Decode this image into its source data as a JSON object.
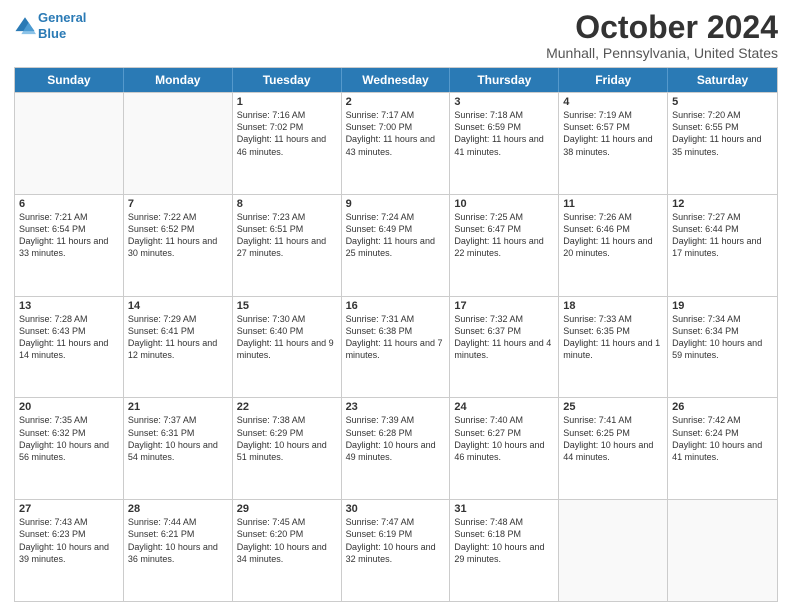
{
  "header": {
    "logo_line1": "General",
    "logo_line2": "Blue",
    "title": "October 2024",
    "subtitle": "Munhall, Pennsylvania, United States"
  },
  "days_of_week": [
    "Sunday",
    "Monday",
    "Tuesday",
    "Wednesday",
    "Thursday",
    "Friday",
    "Saturday"
  ],
  "weeks": [
    [
      {
        "day": "",
        "sunrise": "",
        "sunset": "",
        "daylight": ""
      },
      {
        "day": "",
        "sunrise": "",
        "sunset": "",
        "daylight": ""
      },
      {
        "day": "1",
        "sunrise": "Sunrise: 7:16 AM",
        "sunset": "Sunset: 7:02 PM",
        "daylight": "Daylight: 11 hours and 46 minutes."
      },
      {
        "day": "2",
        "sunrise": "Sunrise: 7:17 AM",
        "sunset": "Sunset: 7:00 PM",
        "daylight": "Daylight: 11 hours and 43 minutes."
      },
      {
        "day": "3",
        "sunrise": "Sunrise: 7:18 AM",
        "sunset": "Sunset: 6:59 PM",
        "daylight": "Daylight: 11 hours and 41 minutes."
      },
      {
        "day": "4",
        "sunrise": "Sunrise: 7:19 AM",
        "sunset": "Sunset: 6:57 PM",
        "daylight": "Daylight: 11 hours and 38 minutes."
      },
      {
        "day": "5",
        "sunrise": "Sunrise: 7:20 AM",
        "sunset": "Sunset: 6:55 PM",
        "daylight": "Daylight: 11 hours and 35 minutes."
      }
    ],
    [
      {
        "day": "6",
        "sunrise": "Sunrise: 7:21 AM",
        "sunset": "Sunset: 6:54 PM",
        "daylight": "Daylight: 11 hours and 33 minutes."
      },
      {
        "day": "7",
        "sunrise": "Sunrise: 7:22 AM",
        "sunset": "Sunset: 6:52 PM",
        "daylight": "Daylight: 11 hours and 30 minutes."
      },
      {
        "day": "8",
        "sunrise": "Sunrise: 7:23 AM",
        "sunset": "Sunset: 6:51 PM",
        "daylight": "Daylight: 11 hours and 27 minutes."
      },
      {
        "day": "9",
        "sunrise": "Sunrise: 7:24 AM",
        "sunset": "Sunset: 6:49 PM",
        "daylight": "Daylight: 11 hours and 25 minutes."
      },
      {
        "day": "10",
        "sunrise": "Sunrise: 7:25 AM",
        "sunset": "Sunset: 6:47 PM",
        "daylight": "Daylight: 11 hours and 22 minutes."
      },
      {
        "day": "11",
        "sunrise": "Sunrise: 7:26 AM",
        "sunset": "Sunset: 6:46 PM",
        "daylight": "Daylight: 11 hours and 20 minutes."
      },
      {
        "day": "12",
        "sunrise": "Sunrise: 7:27 AM",
        "sunset": "Sunset: 6:44 PM",
        "daylight": "Daylight: 11 hours and 17 minutes."
      }
    ],
    [
      {
        "day": "13",
        "sunrise": "Sunrise: 7:28 AM",
        "sunset": "Sunset: 6:43 PM",
        "daylight": "Daylight: 11 hours and 14 minutes."
      },
      {
        "day": "14",
        "sunrise": "Sunrise: 7:29 AM",
        "sunset": "Sunset: 6:41 PM",
        "daylight": "Daylight: 11 hours and 12 minutes."
      },
      {
        "day": "15",
        "sunrise": "Sunrise: 7:30 AM",
        "sunset": "Sunset: 6:40 PM",
        "daylight": "Daylight: 11 hours and 9 minutes."
      },
      {
        "day": "16",
        "sunrise": "Sunrise: 7:31 AM",
        "sunset": "Sunset: 6:38 PM",
        "daylight": "Daylight: 11 hours and 7 minutes."
      },
      {
        "day": "17",
        "sunrise": "Sunrise: 7:32 AM",
        "sunset": "Sunset: 6:37 PM",
        "daylight": "Daylight: 11 hours and 4 minutes."
      },
      {
        "day": "18",
        "sunrise": "Sunrise: 7:33 AM",
        "sunset": "Sunset: 6:35 PM",
        "daylight": "Daylight: 11 hours and 1 minute."
      },
      {
        "day": "19",
        "sunrise": "Sunrise: 7:34 AM",
        "sunset": "Sunset: 6:34 PM",
        "daylight": "Daylight: 10 hours and 59 minutes."
      }
    ],
    [
      {
        "day": "20",
        "sunrise": "Sunrise: 7:35 AM",
        "sunset": "Sunset: 6:32 PM",
        "daylight": "Daylight: 10 hours and 56 minutes."
      },
      {
        "day": "21",
        "sunrise": "Sunrise: 7:37 AM",
        "sunset": "Sunset: 6:31 PM",
        "daylight": "Daylight: 10 hours and 54 minutes."
      },
      {
        "day": "22",
        "sunrise": "Sunrise: 7:38 AM",
        "sunset": "Sunset: 6:29 PM",
        "daylight": "Daylight: 10 hours and 51 minutes."
      },
      {
        "day": "23",
        "sunrise": "Sunrise: 7:39 AM",
        "sunset": "Sunset: 6:28 PM",
        "daylight": "Daylight: 10 hours and 49 minutes."
      },
      {
        "day": "24",
        "sunrise": "Sunrise: 7:40 AM",
        "sunset": "Sunset: 6:27 PM",
        "daylight": "Daylight: 10 hours and 46 minutes."
      },
      {
        "day": "25",
        "sunrise": "Sunrise: 7:41 AM",
        "sunset": "Sunset: 6:25 PM",
        "daylight": "Daylight: 10 hours and 44 minutes."
      },
      {
        "day": "26",
        "sunrise": "Sunrise: 7:42 AM",
        "sunset": "Sunset: 6:24 PM",
        "daylight": "Daylight: 10 hours and 41 minutes."
      }
    ],
    [
      {
        "day": "27",
        "sunrise": "Sunrise: 7:43 AM",
        "sunset": "Sunset: 6:23 PM",
        "daylight": "Daylight: 10 hours and 39 minutes."
      },
      {
        "day": "28",
        "sunrise": "Sunrise: 7:44 AM",
        "sunset": "Sunset: 6:21 PM",
        "daylight": "Daylight: 10 hours and 36 minutes."
      },
      {
        "day": "29",
        "sunrise": "Sunrise: 7:45 AM",
        "sunset": "Sunset: 6:20 PM",
        "daylight": "Daylight: 10 hours and 34 minutes."
      },
      {
        "day": "30",
        "sunrise": "Sunrise: 7:47 AM",
        "sunset": "Sunset: 6:19 PM",
        "daylight": "Daylight: 10 hours and 32 minutes."
      },
      {
        "day": "31",
        "sunrise": "Sunrise: 7:48 AM",
        "sunset": "Sunset: 6:18 PM",
        "daylight": "Daylight: 10 hours and 29 minutes."
      },
      {
        "day": "",
        "sunrise": "",
        "sunset": "",
        "daylight": ""
      },
      {
        "day": "",
        "sunrise": "",
        "sunset": "",
        "daylight": ""
      }
    ]
  ]
}
